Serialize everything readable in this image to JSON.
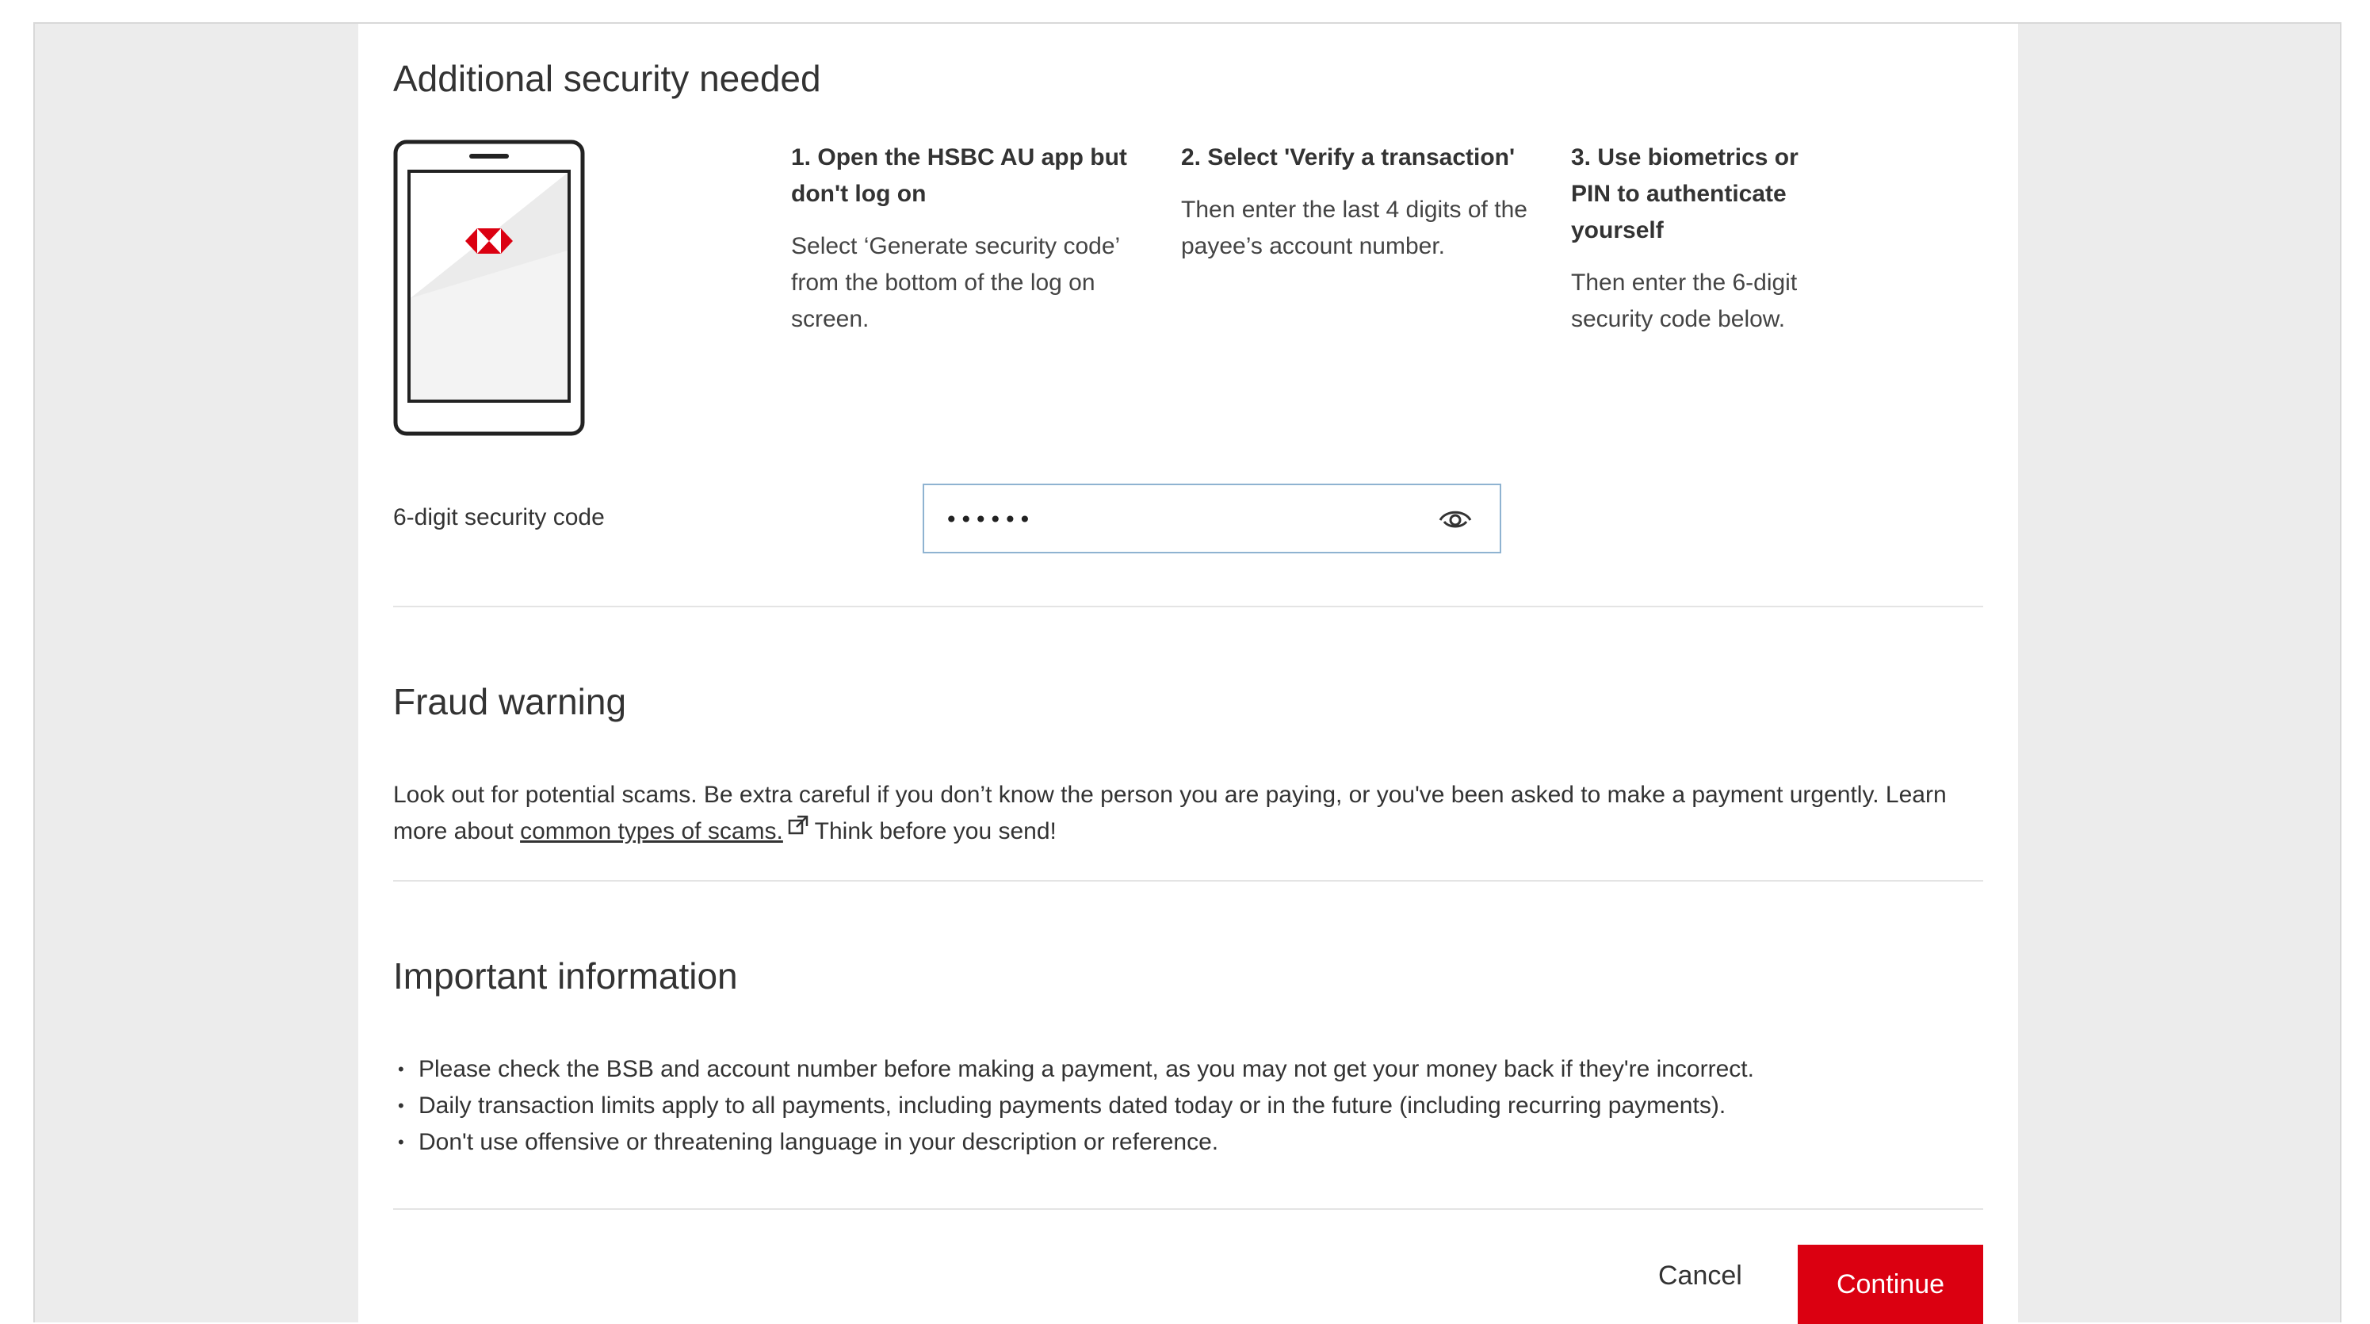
{
  "security": {
    "heading": "Additional security needed",
    "steps": [
      {
        "title": "1. Open the HSBC AU app but don't log on",
        "desc": "Select ‘Generate security code’ from the bottom of the log on screen."
      },
      {
        "title": "2. Select 'Verify a transaction'",
        "desc": "Then enter the last 4 digits of the payee’s account number."
      },
      {
        "title": "3. Use biometrics or PIN to authenticate yourself",
        "desc": "Then enter the 6-digit security code below."
      }
    ],
    "code_label": "6-digit security code",
    "code_value": "••••••"
  },
  "fraud": {
    "heading": "Fraud warning",
    "text_before": "Look out for potential scams. Be extra careful if you don’t know the person you are paying, or you've been asked to make a payment urgently. Learn more about ",
    "link_text": "common types of scams.",
    "text_after": " Think before you send!"
  },
  "important": {
    "heading": "Important information",
    "items": [
      "Please check the BSB and account number before making a payment, as you may not get your money back if they're incorrect.",
      "Daily transaction limits apply to all payments, including payments dated today or in the future (including recurring payments).",
      "Don't use offensive or threatening language in your description or reference."
    ]
  },
  "actions": {
    "cancel_label": "Cancel",
    "continue_label": "Continue"
  },
  "colors": {
    "brand_red": "#db0011",
    "input_border": "#8fb3d1"
  },
  "icons": {
    "phone": "phone-illustration-icon",
    "hsbc_logo": "hsbc-hexagon-logo-icon",
    "eye": "eye-icon",
    "external_link": "external-link-icon"
  }
}
